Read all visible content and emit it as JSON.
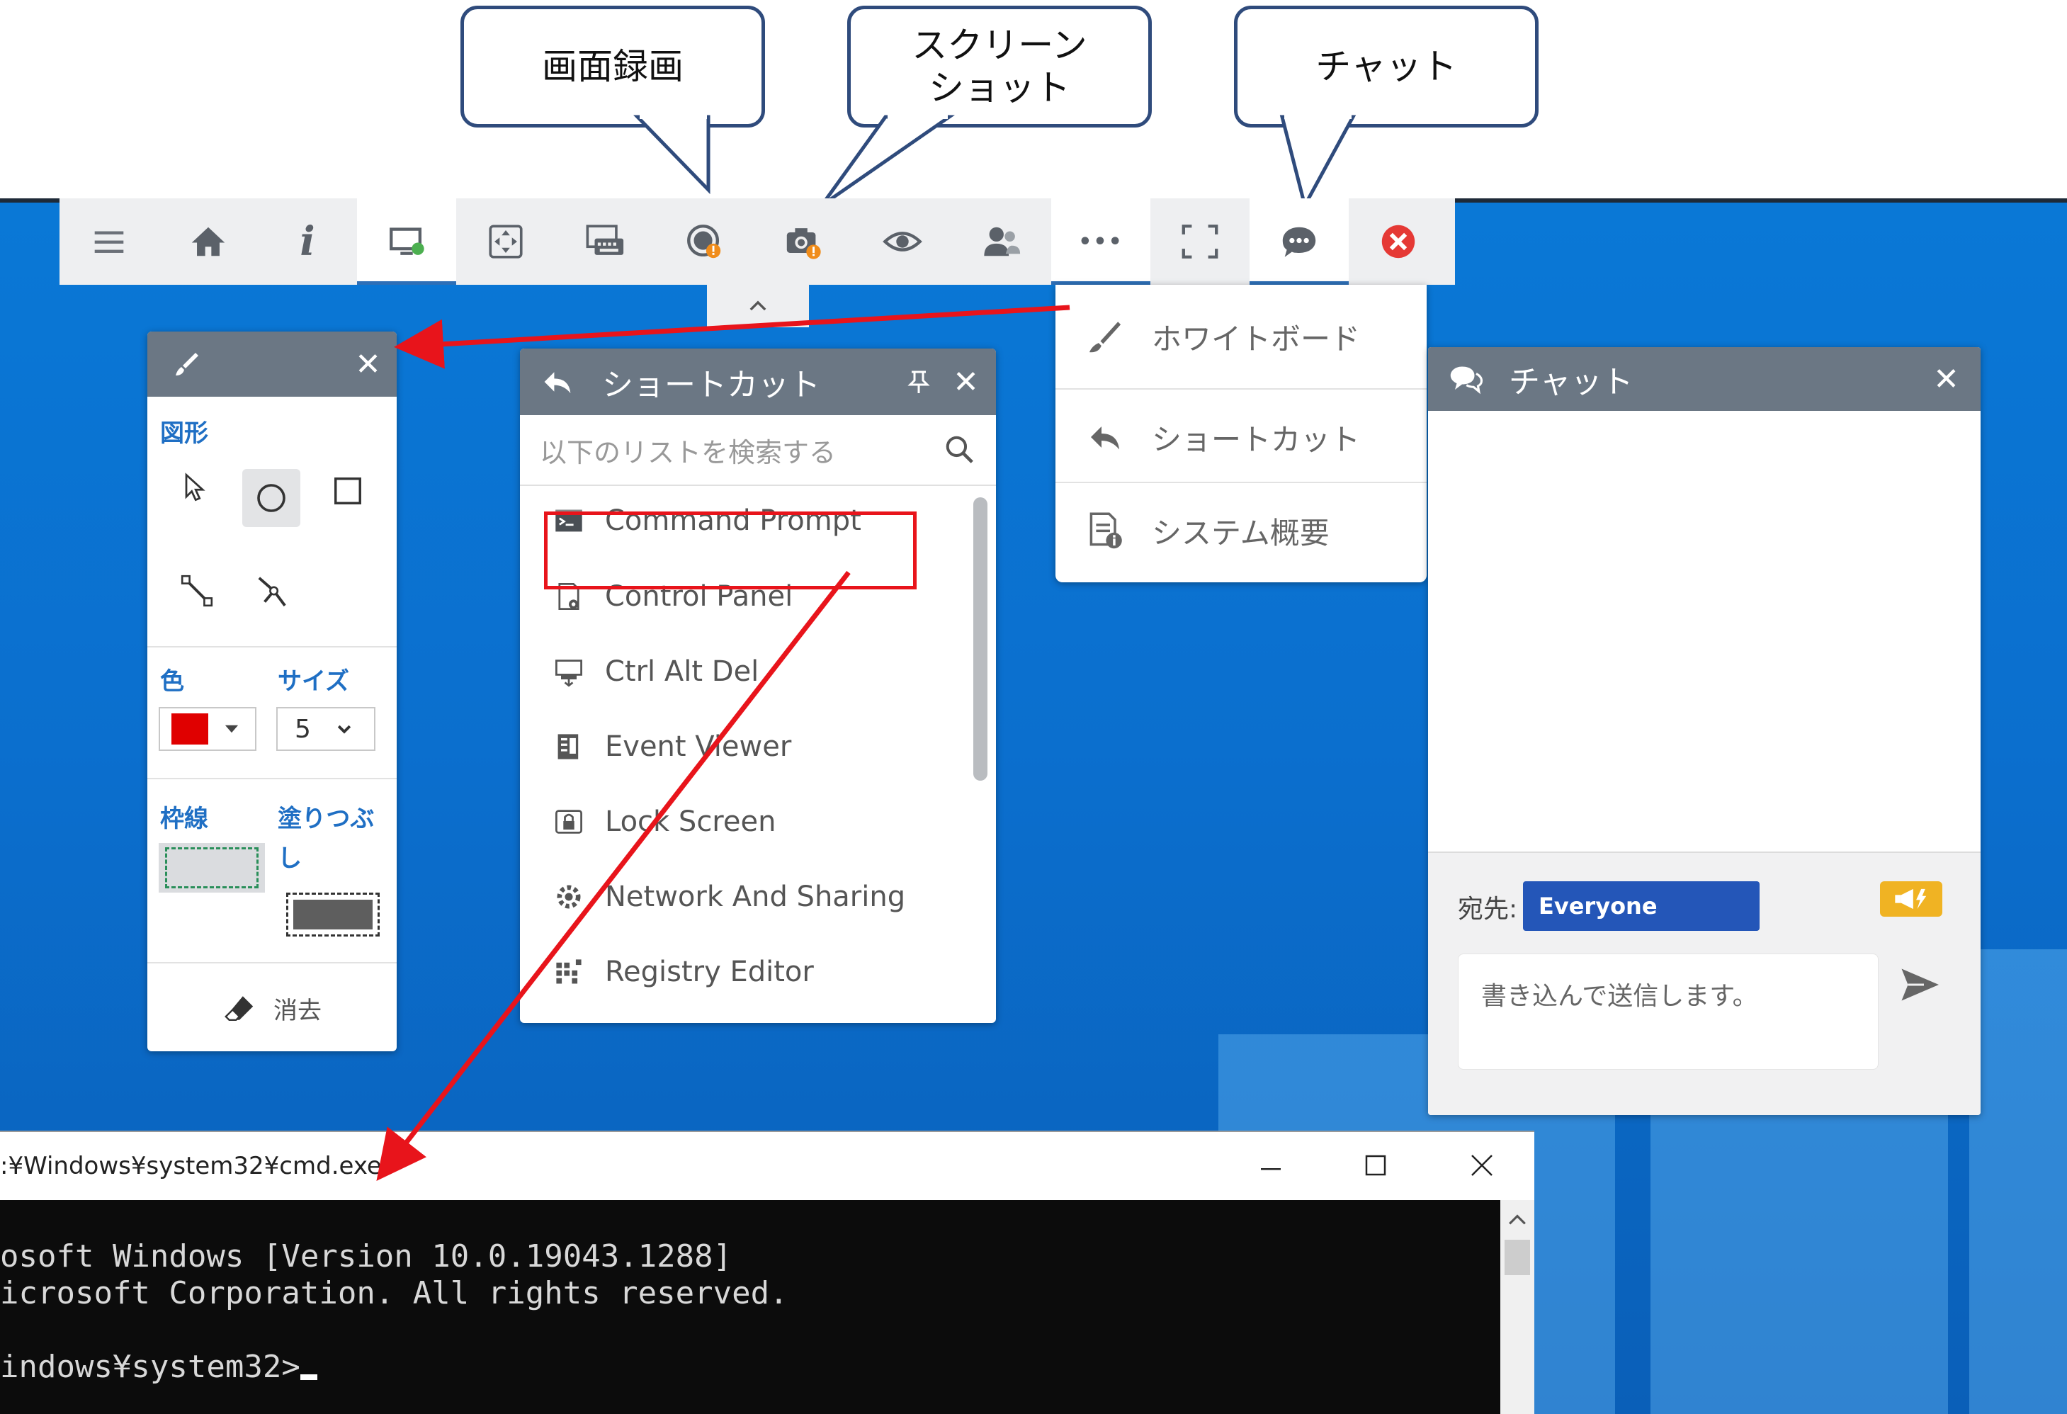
{
  "callouts": {
    "recording": "画面録画",
    "screenshot_line1": "スクリーン",
    "screenshot_line2": "ショット",
    "chat": "チャット"
  },
  "toolbar": {
    "icons": [
      "menu-icon",
      "home-icon",
      "info-icon",
      "monitor-icon",
      "fit-screen-icon",
      "keyboard-icon",
      "record-icon",
      "camera-icon",
      "eye-icon",
      "users-icon",
      "more-icon",
      "fullscreen-icon",
      "chat-icon",
      "close-icon"
    ],
    "info_glyph": "i",
    "more_glyph": "•••"
  },
  "whiteboard": {
    "shapes_label": "図形",
    "color_label": "色",
    "size_label": "サイズ",
    "size_value": "5",
    "border_label": "枠線",
    "fill_label": "塗りつぶし",
    "erase_label": "消去",
    "selected_color": "#e00000"
  },
  "shortcut": {
    "title": "ショートカット",
    "search_placeholder": "以下のリストを検索する",
    "items": [
      "Command Prompt",
      "Control Panel",
      "Ctrl Alt Del",
      "Event Viewer",
      "Lock Screen",
      "Network And Sharing",
      "Registry Editor"
    ]
  },
  "more_menu": {
    "items": [
      "ホワイトボード",
      "ショートカット",
      "システム概要"
    ]
  },
  "chat": {
    "title": "チャット",
    "to_label": "宛先:",
    "recipient": "Everyone",
    "message_placeholder": "書き込んで送信します。"
  },
  "cmd": {
    "title": ":¥Windows¥system32¥cmd.exe",
    "line1": "osoft Windows [Version 10.0.19043.1288]",
    "line2": "icrosoft Corporation. All rights reserved.",
    "line3": "",
    "line4": "indows¥system32>"
  },
  "colors": {
    "accent": "#2e6fb7",
    "header": "#6b7784",
    "highlight_red": "#e8141b",
    "chat_recipient_bg": "#2456b8",
    "broadcast_badge": "#f0b323"
  }
}
